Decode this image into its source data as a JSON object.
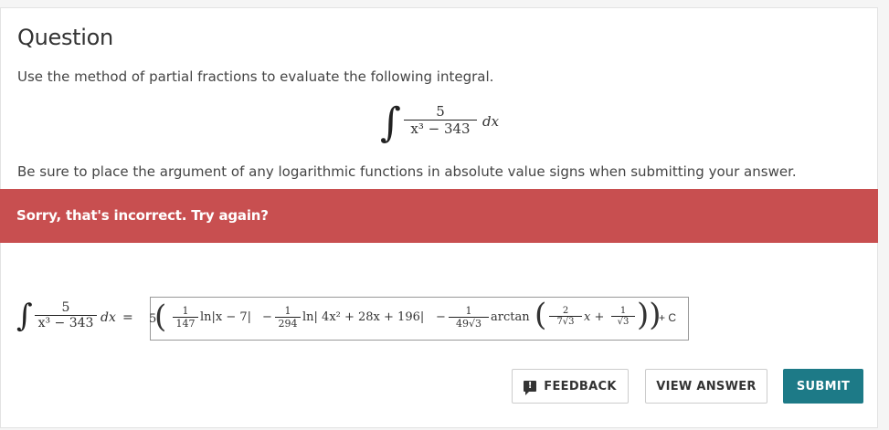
{
  "question": {
    "title": "Question",
    "prompt": "Use the method of partial fractions to evaluate the following integral.",
    "note": "Be sure to place the argument of any logarithmic functions in absolute value signs when submitting your answer.",
    "integral": {
      "numerator": "5",
      "denominator": "x³ − 343",
      "differential": "dx"
    }
  },
  "feedback_banner": {
    "text": "Sorry, that's incorrect. Try again?",
    "color": "#c84f50"
  },
  "answer": {
    "lhs": {
      "numerator": "5",
      "denominator": "x³ − 343",
      "differential": "dx",
      "equals": "="
    },
    "input": {
      "coef": "5",
      "t1": {
        "num": "1",
        "den": "147",
        "func": "ln|x − 7|"
      },
      "minus1": "−",
      "t2": {
        "num": "1",
        "den": "294",
        "func": "ln| 4x² + 28x + 196|"
      },
      "minus2": "−",
      "t3": {
        "num": "1",
        "den": "49√3",
        "func": "arctan"
      },
      "inner": {
        "num1": "2",
        "den1": "7√3",
        "x": "x +",
        "num2": "1",
        "den2": "√3"
      },
      "plus_c": "+ C"
    }
  },
  "buttons": {
    "feedback": "FEEDBACK",
    "view_answer": "VIEW ANSWER",
    "submit": "SUBMIT",
    "submit_color": "#1d7a87"
  }
}
